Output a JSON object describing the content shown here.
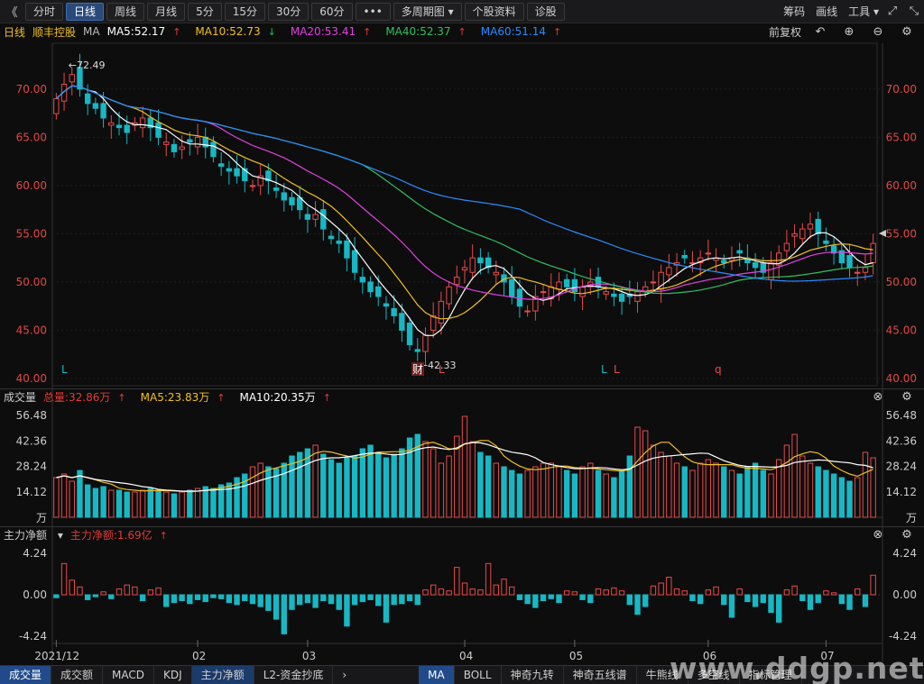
{
  "toolbar": {
    "back": "《",
    "periods": [
      "分时",
      "日线",
      "周线",
      "月线",
      "5分",
      "15分",
      "30分",
      "60分",
      "•••"
    ],
    "active": "日线",
    "multi": "多周期图",
    "profile": "个股资料",
    "diagnose": "诊股",
    "right_links": [
      "筹码",
      "画线",
      "工具"
    ]
  },
  "ma_legend": {
    "period": "日线",
    "stock": "顺丰控股",
    "ma": "MA",
    "items": [
      {
        "label": "MA5:52.17",
        "dir": "up",
        "color": "#ffffff"
      },
      {
        "label": "MA10:52.73",
        "dir": "down",
        "color": "#f0c020"
      },
      {
        "label": "MA20:53.41",
        "dir": "up",
        "color": "#e040e0"
      },
      {
        "label": "MA40:52.37",
        "dir": "up",
        "color": "#30c060"
      },
      {
        "label": "MA60:51.14",
        "dir": "up",
        "color": "#2a8cff"
      }
    ],
    "fuquan": "前复权"
  },
  "volume_legend": {
    "title": "成交量",
    "items": [
      {
        "label": "总量:32.86万",
        "color": "#e03a3a"
      },
      {
        "label": "MA5:23.83万",
        "color": "#f0c020"
      },
      {
        "label": "MA10:20.35万",
        "color": "#ffffff"
      }
    ]
  },
  "net_legend": {
    "title": "主力净额",
    "value": "主力净额:1.69亿"
  },
  "price_axis": [
    "70.00",
    "65.00",
    "60.00",
    "55.00",
    "50.00",
    "45.00",
    "40.00"
  ],
  "volume_axis": [
    "56.48",
    "42.36",
    "28.24",
    "14.12",
    "万"
  ],
  "net_axis": [
    "4.24",
    "0.00",
    "-4.24"
  ],
  "date_axis": [
    "2021/12",
    "02",
    "03",
    "04",
    "05",
    "06",
    "07"
  ],
  "annotations": {
    "high": "72.49",
    "low": "42.33",
    "cai": "财",
    "markers": [
      "L",
      "L",
      "L",
      "L",
      "q"
    ]
  },
  "bottom_tabs": {
    "left": [
      "成交量",
      "成交额",
      "MACD",
      "KDJ",
      "主力净额",
      "L2-资金抄底"
    ],
    "left_active": "成交量",
    "left_highlight": "主力净额",
    "right": [
      "MA",
      "BOLL",
      "神奇九转",
      "神奇五线谱",
      "牛熊线",
      "多空线",
      "指标管理"
    ],
    "right_active": "MA"
  },
  "watermark": "www.ddgp.net",
  "chart_data": {
    "type": "candlestick",
    "ylim": [
      40,
      74
    ],
    "closes": [
      69.0,
      70.5,
      71.5,
      70.0,
      68.5,
      68.0,
      67.0,
      66.5,
      66.0,
      65.5,
      66.5,
      67.0,
      66.0,
      65.0,
      64.5,
      63.5,
      64.0,
      64.5,
      65.0,
      64.0,
      63.0,
      62.0,
      61.5,
      61.0,
      60.5,
      60.0,
      61.0,
      60.5,
      59.5,
      58.5,
      58.0,
      57.5,
      56.5,
      57.0,
      55.5,
      54.5,
      54.0,
      52.5,
      51.0,
      50.0,
      49.0,
      48.5,
      47.5,
      46.5,
      45.0,
      43.5,
      42.8,
      44.5,
      46.5,
      48.0,
      49.5,
      50.5,
      51.5,
      52.5,
      52.0,
      51.5,
      51.0,
      50.0,
      48.5,
      47.5,
      47.0,
      48.5,
      49.0,
      49.5,
      50.0,
      49.5,
      49.0,
      49.5,
      50.0,
      49.5,
      49.0,
      48.5,
      48.0,
      48.5,
      49.0,
      49.5,
      50.0,
      51.0,
      51.5,
      52.0,
      52.5,
      52.0,
      52.5,
      53.0,
      52.5,
      52.0,
      52.5,
      53.0,
      52.0,
      51.5,
      51.0,
      52.0,
      53.0,
      54.0,
      55.0,
      55.5,
      56.0,
      55.0,
      54.0,
      53.0,
      52.0,
      51.5,
      51.0,
      51.5,
      54.0
    ],
    "volume": [
      22,
      24,
      20,
      26,
      18,
      16,
      17,
      15,
      15,
      14,
      14,
      15,
      16,
      15,
      14,
      13,
      14,
      15,
      16,
      17,
      16,
      18,
      19,
      22,
      24,
      28,
      30,
      28,
      27,
      30,
      34,
      36,
      38,
      40,
      35,
      32,
      30,
      33,
      34,
      38,
      40,
      36,
      33,
      35,
      38,
      44,
      46,
      42,
      38,
      30,
      34,
      45,
      56,
      42,
      36,
      34,
      30,
      28,
      26,
      24,
      26,
      28,
      30,
      30,
      28,
      26,
      24,
      28,
      30,
      26,
      24,
      22,
      26,
      34,
      50,
      48,
      40,
      36,
      34,
      30,
      28,
      26,
      30,
      32,
      30,
      28,
      26,
      24,
      28,
      30,
      26,
      24,
      32,
      40,
      46,
      34,
      30,
      28,
      26,
      24,
      22,
      20,
      22,
      36,
      33
    ],
    "net": [
      -0.3,
      3.2,
      1.5,
      0.8,
      -0.5,
      -0.2,
      0.3,
      -0.4,
      0.6,
      1.0,
      0.8,
      -0.6,
      0.5,
      0.7,
      -1.2,
      -0.8,
      -0.6,
      -0.9,
      -0.5,
      -0.7,
      -0.3,
      -0.4,
      -0.8,
      -1.0,
      -0.6,
      -0.9,
      -1.2,
      -1.6,
      -2.5,
      -4.0,
      -1.5,
      -1.0,
      -0.8,
      -1.3,
      -0.6,
      -0.9,
      -1.5,
      -3.2,
      -1.0,
      -0.7,
      -0.5,
      -1.1,
      -2.8,
      -1.0,
      -0.9,
      -0.6,
      -1.0,
      0.5,
      1.0,
      0.6,
      0.4,
      2.8,
      1.2,
      0.6,
      0.5,
      3.2,
      1.0,
      1.6,
      0.8,
      -0.5,
      -0.9,
      -1.3,
      -0.6,
      -0.4,
      -0.8,
      0.4,
      0.3,
      -0.5,
      -0.8,
      0.6,
      0.5,
      0.7,
      0.4,
      -1.0,
      -2.0,
      -1.2,
      0.9,
      1.2,
      1.8,
      0.6,
      0.4,
      -0.6,
      -0.9,
      0.5,
      0.8,
      -1.0,
      -2.3,
      0.6,
      -0.7,
      -1.2,
      -0.8,
      -1.8,
      -2.8,
      0.5,
      0.9,
      -0.6,
      -1.5,
      -0.8,
      0.4,
      0.2,
      -0.9,
      -1.5,
      0.6,
      -1.2,
      2.0
    ],
    "series": [
      "MA5",
      "MA10",
      "MA20",
      "MA40",
      "MA60"
    ]
  }
}
